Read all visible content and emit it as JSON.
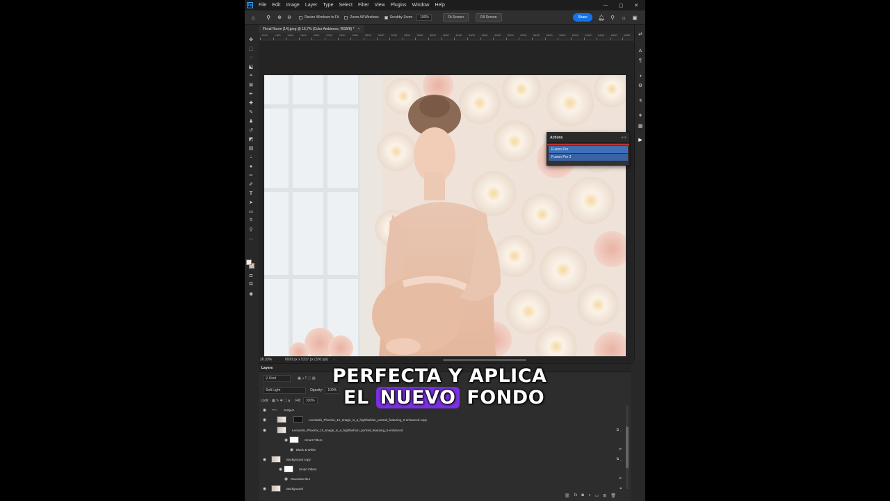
{
  "menubar": {
    "app_logo": "Ps",
    "items": [
      "File",
      "Edit",
      "Image",
      "Layer",
      "Type",
      "Select",
      "Filter",
      "View",
      "Plugins",
      "Window",
      "Help"
    ]
  },
  "options": {
    "resize_windows": "Resize Windows to Fit",
    "zoom_all": "Zoom All Windows",
    "scrubby": "Scrubby Zoom",
    "zoom_value": "100%",
    "fit_screen": "Fit Screen",
    "fill_screen": "Fill Screen",
    "share": "Share"
  },
  "document": {
    "tab_title": "Floral Room (14).jpeg @ 16,7% (Color Ambience, RGB/8) *",
    "tab_close": "×"
  },
  "ruler": {
    "labels": [
      "1200",
      "1400",
      "1600",
      "1800",
      "2000",
      "2200",
      "2400",
      "2600",
      "2800",
      "3000",
      "3200",
      "3400",
      "3600",
      "3800",
      "4000",
      "4200",
      "4400",
      "4600",
      "4800",
      "5000",
      "5200",
      "5400",
      "5600",
      "5800",
      "6000",
      "6200",
      "6400",
      "6600",
      "6800"
    ]
  },
  "actions_panel": {
    "title": "Actions",
    "controls": "»  ≡",
    "items": [
      "Fusion Pro",
      "Fusion Pro 2"
    ]
  },
  "status": {
    "zoom": "26.33%",
    "info": "8000 px x 5317 px (300 ppi)",
    "more": "›"
  },
  "layers_panel": {
    "title": "Layers",
    "kind_label": "Kind",
    "blend_mode": "Soft Light",
    "opacity_label": "Opacity:",
    "opacity_value": "100%",
    "lock_label": "Lock:",
    "fill_label": "Fill:",
    "fill_value": "100%",
    "layers": [
      {
        "name": "Subject",
        "type": "group"
      },
      {
        "name": "Leonardo_Phoenix_10_Image_is_a_highfashion_portrait_featuring_0-enhanced  copy",
        "type": "masked"
      },
      {
        "name": "Leonardo_Phoenix_10_Image_is_a_highfashion_portrait_featuring_0-enhanced",
        "type": "smart"
      },
      {
        "name": "Smart Filters",
        "type": "filter-group"
      },
      {
        "name": "Black & White",
        "type": "filter"
      },
      {
        "name": "Background copy",
        "type": "smart"
      },
      {
        "name": "Smart Filters",
        "type": "filter-group"
      },
      {
        "name": "Gaussian Blur",
        "type": "filter"
      },
      {
        "name": "Background",
        "type": "background"
      }
    ]
  },
  "caption": {
    "line1": "PERFECTA Y APLICA",
    "line2_pre": "EL",
    "line2_highlight": "NUEVO",
    "line2_post": "FONDO"
  },
  "colors": {
    "accent": "#1473e6",
    "caption_highlight": "#7a2fe0",
    "actions_selected": "#3f6fb5",
    "foreground_swatch": "#f6ecd9",
    "background_swatch": "#e7b3a5"
  }
}
